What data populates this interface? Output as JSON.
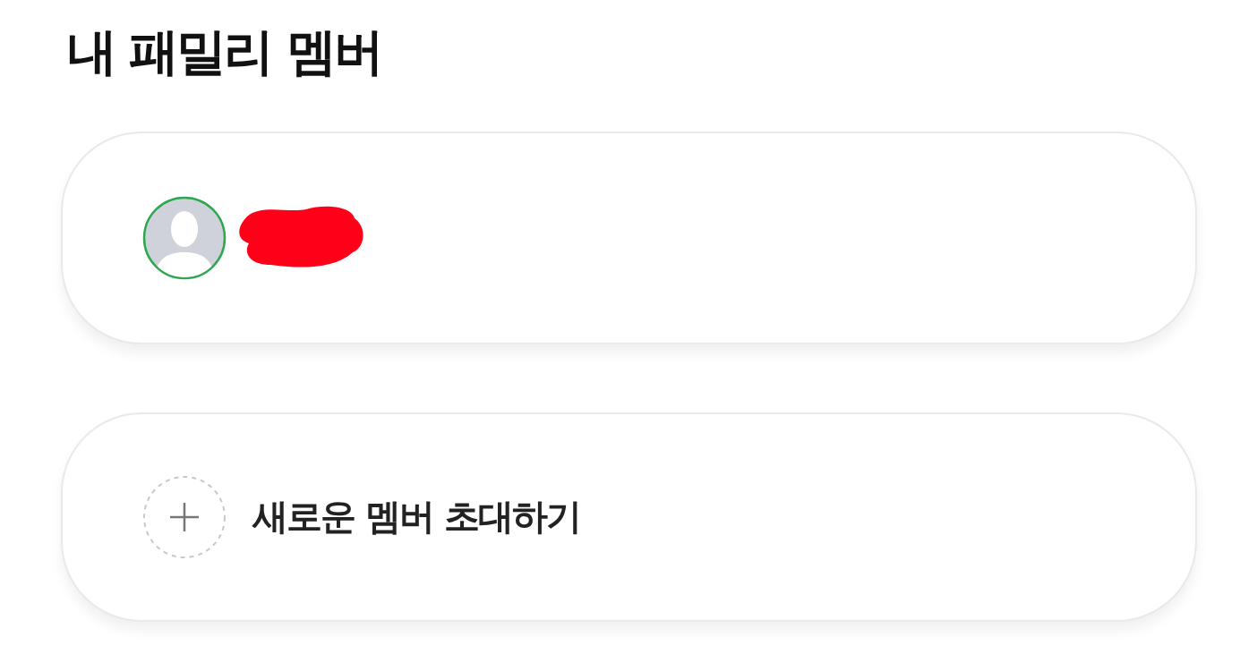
{
  "title": "내 패밀리 멤버",
  "cards": [
    {
      "kind": "member"
    },
    {
      "kind": "invite",
      "label": "새로운 멤버 초대하기"
    }
  ]
}
